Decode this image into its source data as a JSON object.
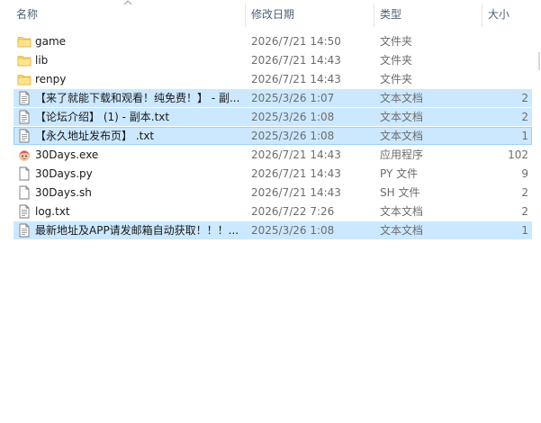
{
  "columns": {
    "name": "名称",
    "date": "修改日期",
    "type": "类型",
    "size": "大小"
  },
  "files": [
    {
      "icon": "folder-icon",
      "name": "game",
      "date": "2026/7/21 14:50",
      "type": "文件夹",
      "size": "",
      "selected": false
    },
    {
      "icon": "folder-icon",
      "name": "lib",
      "date": "2026/7/21 14:43",
      "type": "文件夹",
      "size": "",
      "selected": false
    },
    {
      "icon": "folder-icon",
      "name": "renpy",
      "date": "2026/7/21 14:43",
      "type": "文件夹",
      "size": "",
      "selected": false
    },
    {
      "icon": "text-file-icon",
      "name": "【来了就能下载和观看！纯免费！】 - 副...",
      "date": "2025/3/26 1:07",
      "type": "文本文档",
      "size": "2",
      "selected": true
    },
    {
      "icon": "text-file-icon",
      "name": "【论坛介绍】 (1) - 副本.txt",
      "date": "2025/3/26 1:08",
      "type": "文本文档",
      "size": "2",
      "selected": true
    },
    {
      "icon": "text-file-icon",
      "name": "【永久地址发布页】 .txt",
      "date": "2025/3/26 1:08",
      "type": "文本文档",
      "size": "1",
      "selected": true,
      "focused": true
    },
    {
      "icon": "app-icon",
      "name": "30Days.exe",
      "date": "2026/7/21 14:43",
      "type": "应用程序",
      "size": "102",
      "selected": false
    },
    {
      "icon": "blank-file-icon",
      "name": "30Days.py",
      "date": "2026/7/21 14:43",
      "type": "PY 文件",
      "size": "9",
      "selected": false
    },
    {
      "icon": "blank-file-icon",
      "name": "30Days.sh",
      "date": "2026/7/21 14:43",
      "type": "SH 文件",
      "size": "2",
      "selected": false
    },
    {
      "icon": "text-file-icon",
      "name": "log.txt",
      "date": "2026/7/22 7:26",
      "type": "文本文档",
      "size": "2",
      "selected": false
    },
    {
      "icon": "text-file-icon",
      "name": "最新地址及APP请发邮箱自动获取！！！...",
      "date": "2025/3/26 1:08",
      "type": "文本文档",
      "size": "1",
      "selected": true
    }
  ],
  "colors": {
    "selection": "#cce8ff",
    "focus_border": "#99d1ff",
    "folder": "#f8d775",
    "header_text": "#4c607a"
  }
}
